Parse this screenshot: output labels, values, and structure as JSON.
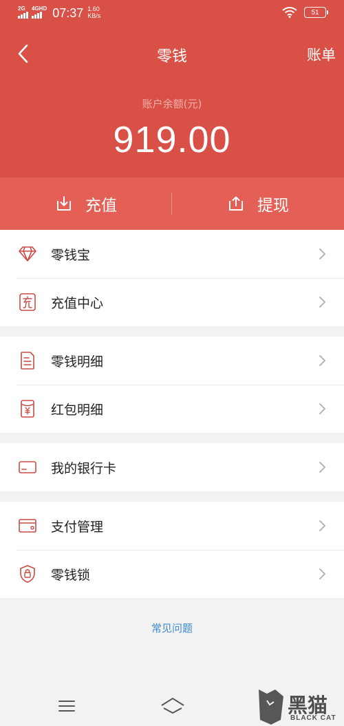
{
  "status_bar": {
    "network_1": "2G",
    "network_2": "4GHD",
    "time": "07:37",
    "speed_value": "1.60",
    "speed_unit": "KB/s",
    "battery": "51"
  },
  "nav": {
    "title": "零钱",
    "right_label": "账单"
  },
  "balance": {
    "label": "账户余额(元)",
    "amount": "919.00"
  },
  "actions": [
    {
      "label": "充值",
      "icon": "recharge-icon"
    },
    {
      "label": "提现",
      "icon": "withdraw-icon"
    }
  ],
  "menu_groups": [
    [
      {
        "label": "零钱宝",
        "icon": "diamond-icon"
      },
      {
        "label": "充值中心",
        "icon": "recharge-center-icon"
      }
    ],
    [
      {
        "label": "零钱明细",
        "icon": "document-icon"
      },
      {
        "label": "红包明细",
        "icon": "red-packet-icon"
      }
    ],
    [
      {
        "label": "我的银行卡",
        "icon": "bank-card-icon"
      }
    ],
    [
      {
        "label": "支付管理",
        "icon": "wallet-icon"
      },
      {
        "label": "零钱锁",
        "icon": "lock-shield-icon"
      }
    ]
  ],
  "faq_link": "常见问题",
  "watermark": {
    "text": "黑猫",
    "sub": "BLACK CAT"
  },
  "colors": {
    "header": "#d95046",
    "action_bar": "#e45f55",
    "icon": "#c94a43",
    "link": "#3d8ad4"
  }
}
